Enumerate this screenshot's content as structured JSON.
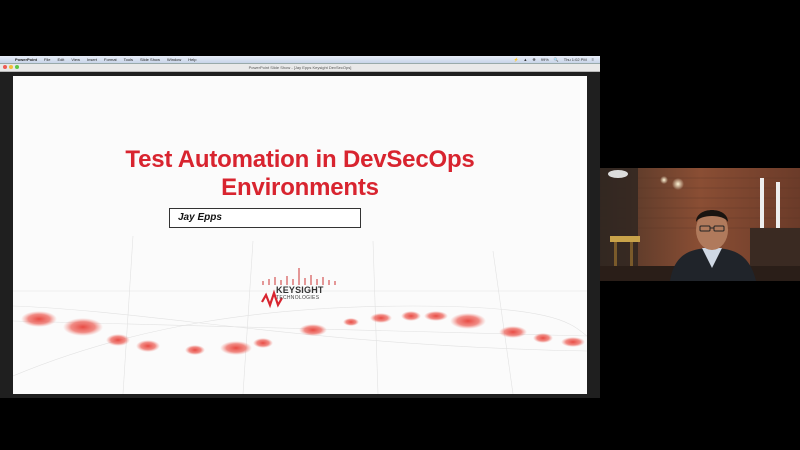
{
  "menubar": {
    "items": [
      "PowerPoint",
      "File",
      "Edit",
      "View",
      "Insert",
      "Format",
      "Tools",
      "Slide Show",
      "Window",
      "Help"
    ],
    "status": [
      "⚡",
      "▲",
      "❋",
      "99%",
      "🔍",
      "Thu 1:02 PM",
      "≡"
    ]
  },
  "window": {
    "title": "PowerPoint Slide Show - [Jay Epps Keysight DevSecOps]"
  },
  "slide": {
    "title_line1": "Test Automation in DevSecOps",
    "title_line2": "Environments",
    "presenter": "Jay Epps",
    "logo_brand": "KEYSIGHT",
    "logo_sub": "TECHNOLOGIES",
    "accent_color": "#d8242f"
  },
  "webcam": {
    "description_icon": "presenter-video-icon"
  }
}
